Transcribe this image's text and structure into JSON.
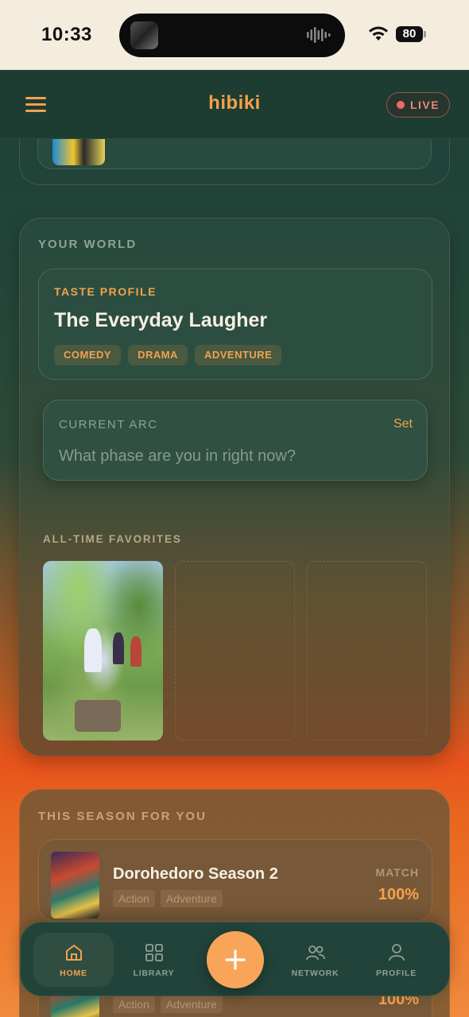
{
  "status_bar": {
    "time": "10:33",
    "battery": "80"
  },
  "header": {
    "brand": "hibiki",
    "live_label": "LIVE"
  },
  "your_world": {
    "section_title": "YOUR WORLD",
    "taste_profile": {
      "label": "TASTE PROFILE",
      "name": "The Everyday Laugher",
      "tags": [
        "COMEDY",
        "DRAMA",
        "ADVENTURE"
      ]
    },
    "current_arc": {
      "label": "CURRENT ARC",
      "action": "Set",
      "placeholder": "What phase are you in right now?"
    },
    "favorites": {
      "title": "ALL-TIME FAVORITES"
    }
  },
  "season": {
    "title": "THIS SEASON FOR YOU",
    "items": [
      {
        "title": "Dorohedoro Season 2",
        "tags": [
          "Action",
          "Adventure"
        ],
        "match_label": "MATCH",
        "match": "100%"
      },
      {
        "title": "",
        "tags": [
          "Action",
          "Adventure"
        ],
        "match_label": "",
        "match": "100%"
      }
    ]
  },
  "nav": {
    "home": "HOME",
    "library": "LIBRARY",
    "network": "NETWORK",
    "profile": "PROFILE"
  },
  "colors": {
    "accent": "#f0a24e",
    "live": "#ef6a5f",
    "header_bg": "#1d3c32"
  }
}
